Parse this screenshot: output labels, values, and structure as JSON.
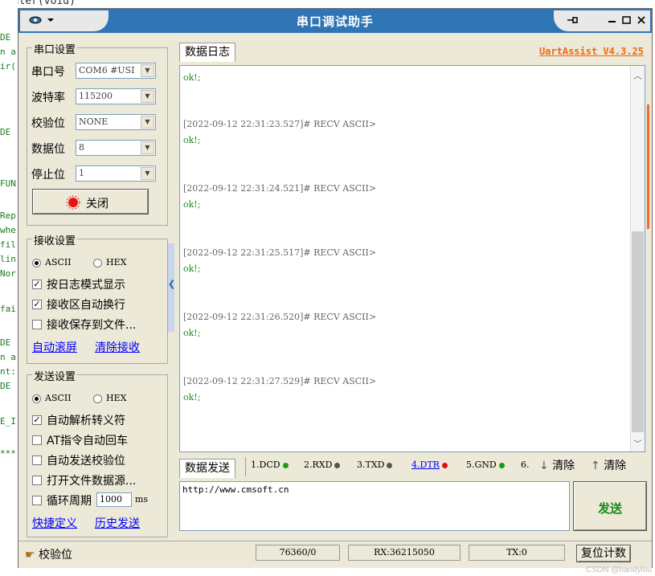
{
  "background_code": {
    "top_line": "andler(void)",
    "fragments": [
      "DE",
      "n a",
      "ir(",
      "DE",
      "FUN",
      "Rep",
      "whe",
      "fil",
      "lin",
      "Nor",
      "fai",
      "DE",
      "n a",
      "nt:",
      "DE",
      "E_I",
      "***"
    ]
  },
  "window": {
    "title": "串口调试助手",
    "version": "UartAssist V4.3.25"
  },
  "port_settings": {
    "title": "串口设置",
    "port_label": "串口号",
    "port_value": "COM6 #USI",
    "baud_label": "波特率",
    "baud_value": "115200",
    "parity_label": "校验位",
    "parity_value": "NONE",
    "databits_label": "数据位",
    "databits_value": "8",
    "stopbits_label": "停止位",
    "stopbits_value": "1",
    "toggle_label": "关闭"
  },
  "receive_settings": {
    "title": "接收设置",
    "mode_ascii": "ASCII",
    "mode_hex": "HEX",
    "opt_log_mode": "按日志模式显示",
    "opt_auto_wrap": "接收区自动换行",
    "opt_save_file": "接收保存到文件...",
    "link_auto_scroll": "自动滚屏",
    "link_clear": "清除接收"
  },
  "send_settings": {
    "title": "发送设置",
    "mode_ascii": "ASCII",
    "mode_hex": "HEX",
    "opt_auto_parse": "自动解析转义符",
    "opt_at_cr": "AT指令自动回车",
    "opt_auto_check": "自动发送校验位",
    "opt_open_file": "打开文件数据源...",
    "opt_loop": "循环周期",
    "loop_value": "1000",
    "loop_unit": "ms",
    "link_shortcut": "快捷定义",
    "link_history": "历史发送"
  },
  "log": {
    "tab": "数据日志",
    "entries": [
      {
        "ts": "",
        "msg": "ok!;"
      },
      {
        "ts": "[2022-09-12 22:31:23.527]# RECV ASCII>",
        "msg": "ok!;"
      },
      {
        "ts": "[2022-09-12 22:31:24.521]# RECV ASCII>",
        "msg": "ok!;"
      },
      {
        "ts": "[2022-09-12 22:31:25.517]# RECV ASCII>",
        "msg": "ok!;"
      },
      {
        "ts": "[2022-09-12 22:31:26.520]# RECV ASCII>",
        "msg": "ok!;"
      },
      {
        "ts": "[2022-09-12 22:31:27.529]# RECV ASCII>",
        "msg": "ok!;"
      }
    ]
  },
  "send_area": {
    "tab": "数据发送",
    "pins": [
      {
        "label": "1.DCD",
        "color": "#1a9a1a",
        "link": false
      },
      {
        "label": "2.RXD",
        "color": "#555555",
        "link": false
      },
      {
        "label": "3.TXD",
        "color": "#555555",
        "link": false
      },
      {
        "label": "4.DTR",
        "color": "#e01010",
        "link": true
      },
      {
        "label": "5.GND",
        "color": "#1a9a1a",
        "link": false
      },
      {
        "label": "6.",
        "color": "",
        "link": false
      }
    ],
    "clear1": "清除",
    "clear2": "清除",
    "input_value": "http://www.cmsoft.cn",
    "send_button": "发送"
  },
  "statusbar": {
    "hint": "校验位",
    "counter1": "76360/0",
    "rx": "RX:36215050",
    "tx": "TX:0",
    "reset": "复位计数"
  },
  "watermark": "CSDN @handylou"
}
